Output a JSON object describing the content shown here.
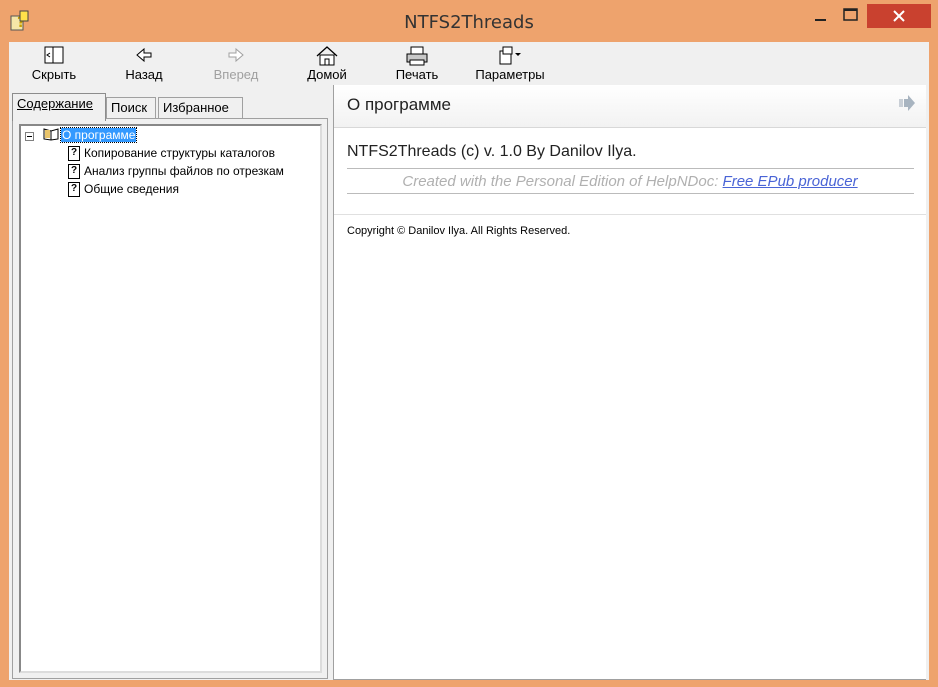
{
  "window": {
    "title": "NTFS2Threads"
  },
  "toolbar": {
    "hide": "Скрыть",
    "back": "Назад",
    "forward": "Вперед",
    "home": "Домой",
    "print": "Печать",
    "options": "Параметры"
  },
  "tabs": [
    "Содержание",
    "Поиск",
    "Избранное"
  ],
  "tree": {
    "root": "О программе",
    "children": [
      "Копирование структуры каталогов",
      "Анализ группы файлов по отрезкам",
      "Общие сведения"
    ]
  },
  "content": {
    "title": "О программе",
    "main_text": "NTFS2Threads (c) v. 1.0 By Danilov Ilya.",
    "credit_prefix": "Created with the Personal Edition of HelpNDoc: ",
    "credit_link": "Free EPub producer",
    "copyright": "Copyright © Danilov Ilya. All Rights Reserved."
  },
  "colors": {
    "frame": "#eea36d",
    "close_button": "#c9412f",
    "selection": "#3399ff",
    "link": "#4a64d6"
  }
}
